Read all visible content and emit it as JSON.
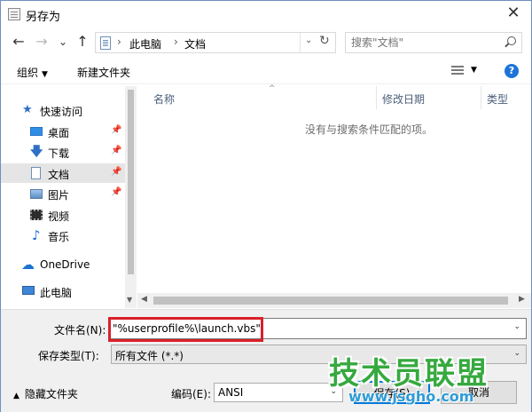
{
  "window": {
    "title": "另存为",
    "close_glyph": "✕"
  },
  "address": {
    "back_glyph": "←",
    "forward_glyph": "→",
    "recent_glyph": "⌄",
    "up_glyph": "↑",
    "crumb_sep": "›",
    "crumbs": [
      "此电脑",
      "文档"
    ],
    "dropdown_glyph": "⌄",
    "refresh_glyph": "↻"
  },
  "search": {
    "placeholder": "搜索\"文档\""
  },
  "toolbar": {
    "organize_label": "组织",
    "new_folder_label": "新建文件夹",
    "caret_glyph": "▼",
    "help_glyph": "?"
  },
  "sidebar": {
    "pin_glyph": "📌",
    "items": [
      {
        "label": "快速访问",
        "icon": "star-icon",
        "glyph": "★"
      },
      {
        "label": "桌面",
        "icon": "desktop-icon"
      },
      {
        "label": "下载",
        "icon": "download-icon",
        "glyph": "🡇"
      },
      {
        "label": "文档",
        "icon": "document-icon"
      },
      {
        "label": "图片",
        "icon": "picture-icon"
      },
      {
        "label": "视频",
        "icon": "video-icon"
      },
      {
        "label": "音乐",
        "icon": "music-icon",
        "glyph": "♪"
      },
      {
        "label": "OneDrive",
        "icon": "cloud-icon",
        "glyph": "☁"
      },
      {
        "label": "此电脑",
        "icon": "computer-icon"
      }
    ]
  },
  "file_list": {
    "columns": [
      "名称",
      "修改日期",
      "类型"
    ],
    "sort_glyph": "^",
    "empty_message": "没有与搜索条件匹配的项。"
  },
  "scroll": {
    "up": "▲",
    "down": "▼",
    "left": "◀",
    "right": "▶"
  },
  "form": {
    "filename_label": "文件名(N):",
    "filename_value": "\"%userprofile%\\launch.vbs\"",
    "filetype_label": "保存类型(T):",
    "filetype_value": "所有文件 (*.*)",
    "hide_folders_label": "隐藏文件夹",
    "hide_caret": "▲",
    "encoding_label": "编码(E):",
    "encoding_value": "ANSI",
    "save_label": "保存(S)",
    "cancel_label": "取消",
    "dropdown_glyph": "⌄"
  },
  "watermark": {
    "title": "技术员联盟",
    "url": "www.jsgho.com"
  },
  "colors": {
    "accent": "#0078d7",
    "highlight_border": "#d9202a",
    "watermark_green": "#36a93f",
    "watermark_blue": "#2f9bd5"
  }
}
